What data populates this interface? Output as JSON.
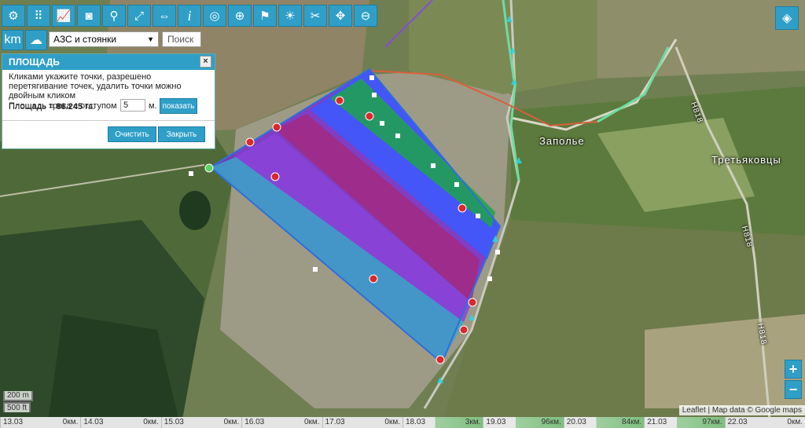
{
  "toolbar": {
    "icons": [
      "settings-icon",
      "grid-icon",
      "chart-icon",
      "camera-icon",
      "geofence-icon",
      "fullscreen-icon",
      "speed-icon",
      "info-icon",
      "target-icon",
      "crosshair-icon",
      "marker-icon",
      "sunrise-icon",
      "scissors-icon",
      "move-icon",
      "remove-icon"
    ],
    "km_label": "km"
  },
  "filter": {
    "selected": "АЗС и стоянки",
    "search_placeholder": "Поиск"
  },
  "area_panel": {
    "title": "ПЛОЩАДЬ",
    "hint": "Кликами укажите точки, разрешено перетягивание точек, удалить точки можно двойным кликом",
    "area_label": "Площадь = ",
    "area_value": "86.245",
    "area_unit": "га.",
    "track_label": "Площадь трека с отступом",
    "offset_value": "5",
    "offset_unit": "м.",
    "show_button": "показать",
    "clear_button": "Очистить",
    "close_button": "Закрыть",
    "close_x": "×"
  },
  "map": {
    "place_labels": [
      "Заполье",
      "Третьяковцы",
      "Н818",
      "Н818",
      "Н818"
    ],
    "scale_top": "200 m",
    "scale_bottom": "500 ft",
    "attribution": "Leaflet | Map data © Google maps"
  },
  "zoom": {
    "in": "+",
    "out": "−"
  },
  "timeline": {
    "entries": [
      {
        "date": "13.03",
        "dist": "0км."
      },
      {
        "date": "14.03",
        "dist": "0км."
      },
      {
        "date": "15.03",
        "dist": "0км."
      },
      {
        "date": "16.03",
        "dist": "0км."
      },
      {
        "date": "17.03",
        "dist": "0км."
      },
      {
        "date": "18.03",
        "dist": "3км."
      },
      {
        "date": "19.03",
        "dist": "96км."
      },
      {
        "date": "20.03",
        "dist": "84км."
      },
      {
        "date": "21.03",
        "dist": "97км."
      },
      {
        "date": "22.03",
        "dist": "0км."
      }
    ]
  },
  "colors": {
    "accent": "#2f9fc7",
    "band_purple": "#7a2fd0",
    "band_blue": "#3a5bff",
    "band_green": "#1ea34a",
    "band_teal": "#3aa6c8",
    "band_magenta": "#a6287c"
  }
}
